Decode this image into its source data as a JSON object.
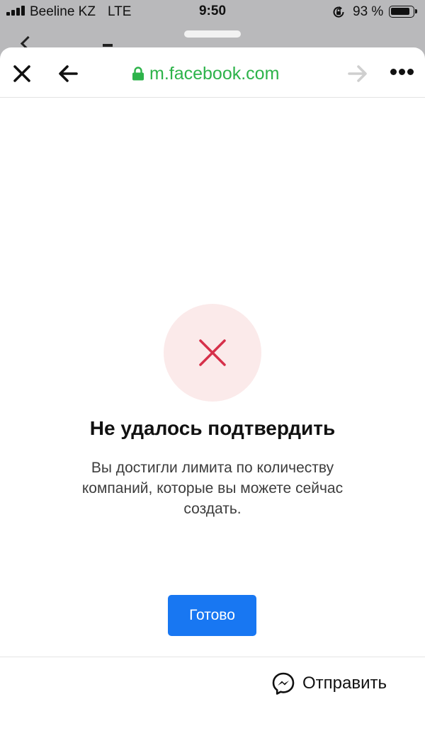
{
  "status_bar": {
    "carrier": "Beeline KZ",
    "network": "LTE",
    "time": "9:50",
    "battery_percent": "93 %",
    "battery_level": 0.93,
    "icons": [
      "signal-icon",
      "rotation-lock-icon",
      "battery-icon"
    ]
  },
  "browser": {
    "url": "m.facebook.com",
    "icons": [
      "close-icon",
      "back-arrow-icon",
      "lock-icon",
      "forward-arrow-icon",
      "more-icon"
    ]
  },
  "error": {
    "icon": "close-icon",
    "title": "Не удалось подтвердить",
    "message": "Вы достигли лимита по количеству компаний, которые вы можете сейчас создать.",
    "done_label": "Готово"
  },
  "bottom_bar": {
    "send_label": "Отправить",
    "icon": "messenger-icon"
  },
  "colors": {
    "accent": "#1877f2",
    "url_secure": "#2db34a",
    "error_red": "#d6304a",
    "error_bg": "#fbeaea",
    "backdrop": "#b9b9bb"
  }
}
